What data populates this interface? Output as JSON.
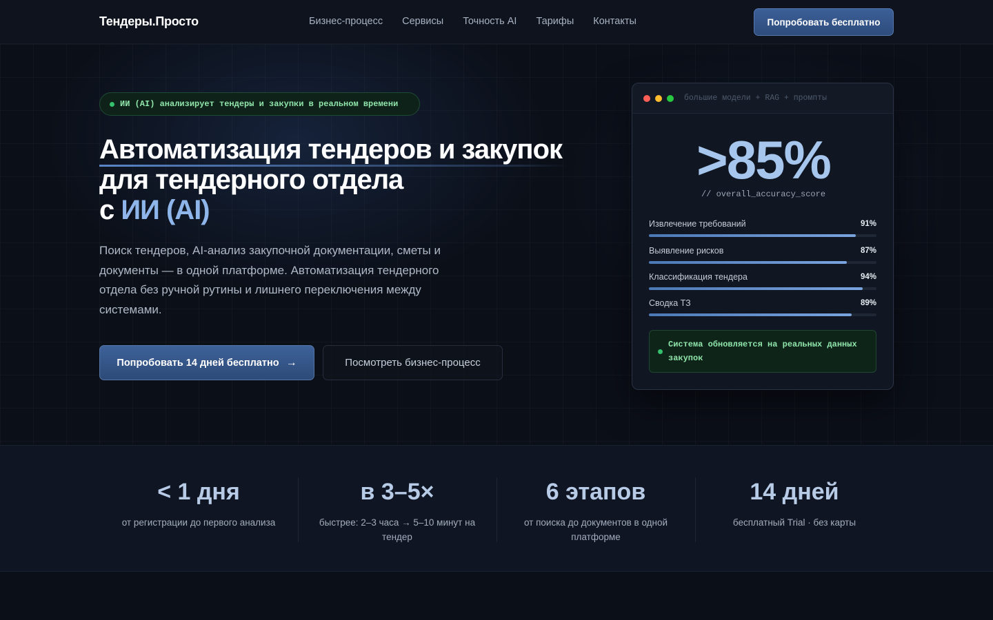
{
  "header": {
    "logo": "Тендеры.Просто",
    "nav": [
      "Бизнес-процесс",
      "Сервисы",
      "Точность AI",
      "Тарифы",
      "Контакты"
    ],
    "cta": "Попробовать бесплатно"
  },
  "hero": {
    "badge": "ИИ (AI) анализирует тендеры и закупки в реальном времени",
    "title_line1": "Автоматизация тендеров и закупок",
    "title_line2": "для тендерного отдела",
    "title_line3_prefix": "с",
    "title_line3_accent": "ИИ (AI)",
    "subtitle": "Поиск тендеров, AI-анализ закупочной документации, сметы и документы — в одной платформе. Автоматизация тендерного отдела без ручной рутины и лишнего переключения между системами.",
    "primary_btn": "Попробовать 14 дней бесплатно",
    "primary_arrow": "→",
    "secondary_btn": "Посмотреть бизнес-процесс"
  },
  "card": {
    "caption": "большие модели + RAG + промпты",
    "big_value": ">85%",
    "big_caption": "// overall_accuracy_score",
    "metrics": [
      {
        "label": "Извлечение требований",
        "value": "91%",
        "fraction": 0.91
      },
      {
        "label": "Выявление рисков",
        "value": "87%",
        "fraction": 0.87
      },
      {
        "label": "Классификация тендера",
        "value": "94%",
        "fraction": 0.94
      },
      {
        "label": "Сводка ТЗ",
        "value": "89%",
        "fraction": 0.89
      }
    ],
    "status": "Система обновляется на реальных данных закупок",
    "dot_colors": [
      "#ff5f57",
      "#febc2e",
      "#28c840"
    ]
  },
  "stats": [
    {
      "num": "< 1 дня",
      "desc": "от регистрации до первого анализа"
    },
    {
      "num": "в 3–5×",
      "desc": "быстрее: 2–3 часа → 5–10 минут на тендер"
    },
    {
      "num": "6 этапов",
      "desc": "от поиска до документов в одной платформе"
    },
    {
      "num": "14 дней",
      "desc": "бесплатный Trial · без карты"
    }
  ]
}
